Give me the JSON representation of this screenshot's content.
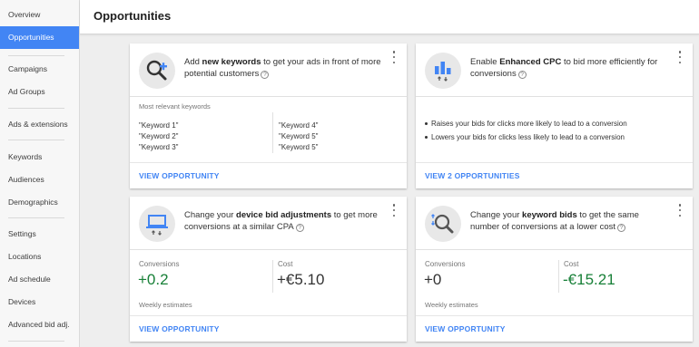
{
  "sidebar": {
    "items": [
      {
        "label": "Overview",
        "active": false
      },
      {
        "label": "Opportunities",
        "active": true
      },
      {
        "label": "Campaigns",
        "active": false
      },
      {
        "label": "Ad Groups",
        "active": false
      },
      {
        "label": "Ads & extensions",
        "active": false
      },
      {
        "label": "Keywords",
        "active": false
      },
      {
        "label": "Audiences",
        "active": false
      },
      {
        "label": "Demographics",
        "active": false
      },
      {
        "label": "Settings",
        "active": false
      },
      {
        "label": "Locations",
        "active": false
      },
      {
        "label": "Ad schedule",
        "active": false
      },
      {
        "label": "Devices",
        "active": false
      },
      {
        "label": "Advanced bid adj.",
        "active": false
      }
    ]
  },
  "header": {
    "title": "Opportunities"
  },
  "cards": {
    "keywords": {
      "icon": "magnifier-plus-icon",
      "pre": "Add ",
      "bold": "new keywords",
      "post": " to get your ads in front of more potential customers",
      "section_label": "Most relevant keywords",
      "left_keywords": [
        "\"Keyword 1\"",
        "\"Keyword 2\"",
        "\"Keyword 3\""
      ],
      "right_keywords": [
        "\"Keyword 4\"",
        "\"Keyword 5\"",
        "\"Keyword 5\""
      ],
      "link": "VIEW OPPORTUNITY"
    },
    "ecpc": {
      "icon": "bar-chart-arrows-icon",
      "pre": "Enable ",
      "bold": "Enhanced CPC",
      "post": " to bid more efficiently for conversions",
      "bullets": [
        "Raises your bids for clicks more likely to lead to a conversion",
        "Lowers your bids for clicks less likely to lead to a conversion"
      ],
      "link": "VIEW 2 OPPORTUNITIES"
    },
    "device": {
      "icon": "laptop-arrows-icon",
      "pre": "Change your ",
      "bold": "device bid adjustments",
      "post": " to get more conversions at a similar CPA",
      "conversions_label": "Conversions",
      "conversions_value": "+0.2",
      "cost_label": "Cost",
      "cost_value": "+€5.10",
      "weekly": "Weekly estimates",
      "link": "VIEW OPPORTUNITY"
    },
    "keyword_bids": {
      "icon": "magnifier-arrows-icon",
      "pre": "Change your ",
      "bold": "keyword bids",
      "post": " to get the same number of conversions at a lower cost",
      "conversions_label": "Conversions",
      "conversions_value": "+0",
      "cost_label": "Cost",
      "cost_value": "-€15.21",
      "weekly": "Weekly estimates",
      "link": "VIEW OPPORTUNITY"
    }
  },
  "colors": {
    "accent": "#4285f4",
    "positive": "#188038",
    "sidebar_bg": "#f7f7f7"
  }
}
